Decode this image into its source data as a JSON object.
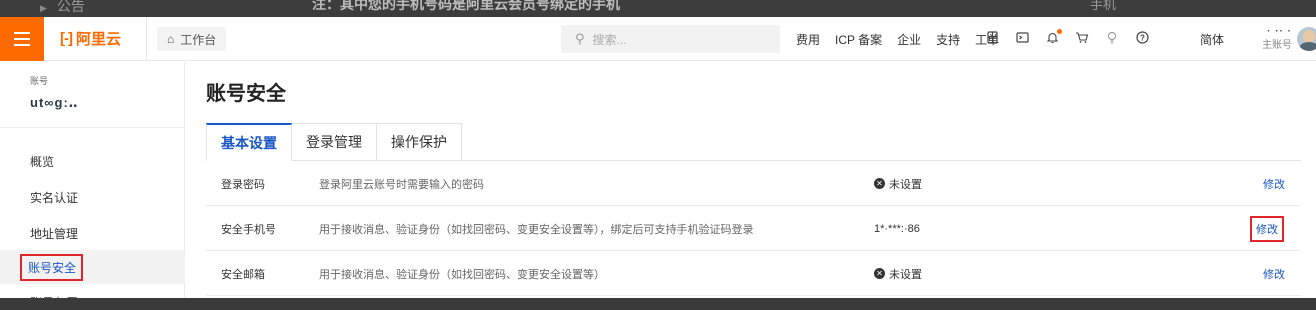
{
  "backdrop": {
    "left_text": "公告",
    "mid_text": "注：其中您的手机号码是阿里云会员号绑定的手机",
    "right_text": "手机"
  },
  "topbar": {
    "logo_mark": "[-]",
    "logo_text": "阿里云",
    "workbench_label": "工作台",
    "search_placeholder": "搜索...",
    "nav_links": [
      "费用",
      "ICP 备案",
      "企业",
      "支持",
      "工单"
    ],
    "icons": [
      "app-icon",
      "terminal-icon",
      "bell-icon",
      "cart-icon",
      "bulb-icon",
      "help-icon"
    ],
    "lang": "简体",
    "account_name": "· ·· ·",
    "account_role": "主账号"
  },
  "sidebar": {
    "label": "账号",
    "username": "ut∞g:‥",
    "items": [
      {
        "label": "概览"
      },
      {
        "label": "实名认证"
      },
      {
        "label": "地址管理"
      },
      {
        "label": "账号安全"
      },
      {
        "label": "账号归属"
      }
    ]
  },
  "main": {
    "title": "账号安全",
    "tabs": [
      {
        "label": "基本设置"
      },
      {
        "label": "登录管理"
      },
      {
        "label": "操作保护"
      }
    ],
    "rows": [
      {
        "name": "登录密码",
        "desc": "登录阿里云账号时需要输入的密码",
        "status": "未设置",
        "action": "修改"
      },
      {
        "name": "安全手机号",
        "desc": "用于接收消息、验证身份（如找回密码、变更安全设置等），绑定后可支持手机验证码登录",
        "status": "1*·***:·86",
        "action": "修改"
      },
      {
        "name": "安全邮箱",
        "desc": "用于接收消息、验证身份（如找回密码、变更安全设置等）",
        "status": "未设置",
        "action": "修改"
      }
    ]
  },
  "colors": {
    "brand": "#ff6a00",
    "link": "#1a56c7",
    "highlight_box": "#e0262b"
  }
}
